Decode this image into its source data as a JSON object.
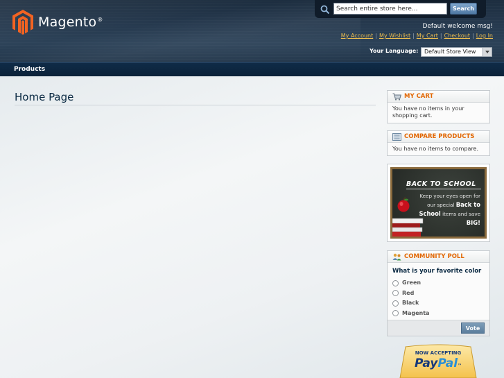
{
  "brand": {
    "name": "Magento",
    "reg": "®"
  },
  "search": {
    "placeholder": "Search entire store here...",
    "button": "Search"
  },
  "header": {
    "welcome": "Default welcome msg!",
    "links": [
      "My Account",
      "My Wishlist",
      "My Cart",
      "Checkout",
      "Log In"
    ],
    "language_label": "Your Language:",
    "language_value": "Default Store View"
  },
  "nav": {
    "items": [
      "Products"
    ]
  },
  "main": {
    "title": "Home Page"
  },
  "sidebar": {
    "cart": {
      "title": "My Cart",
      "body": "You have no items in your shopping cart."
    },
    "compare": {
      "title": "Compare Products",
      "body": "You have no items to compare."
    },
    "banner": {
      "heading": "BACK TO SCHOOL",
      "line1": "Keep your eyes open for our special",
      "bold1": "Back to School",
      "line2": "items and save",
      "bold2": "BIG!"
    },
    "poll": {
      "title": "Community Poll",
      "question": "What is your favorite color",
      "options": [
        "Green",
        "Red",
        "Black",
        "Magenta"
      ],
      "vote": "Vote"
    },
    "paypal": {
      "top": "NOW ACCEPTING",
      "brand_a": "Pay",
      "brand_b": "Pal",
      "tm": "™"
    }
  },
  "colors": {
    "accent": "#e26703",
    "header": "#25384d",
    "nav": "#0f2b47",
    "link": "#ebbc4e"
  }
}
